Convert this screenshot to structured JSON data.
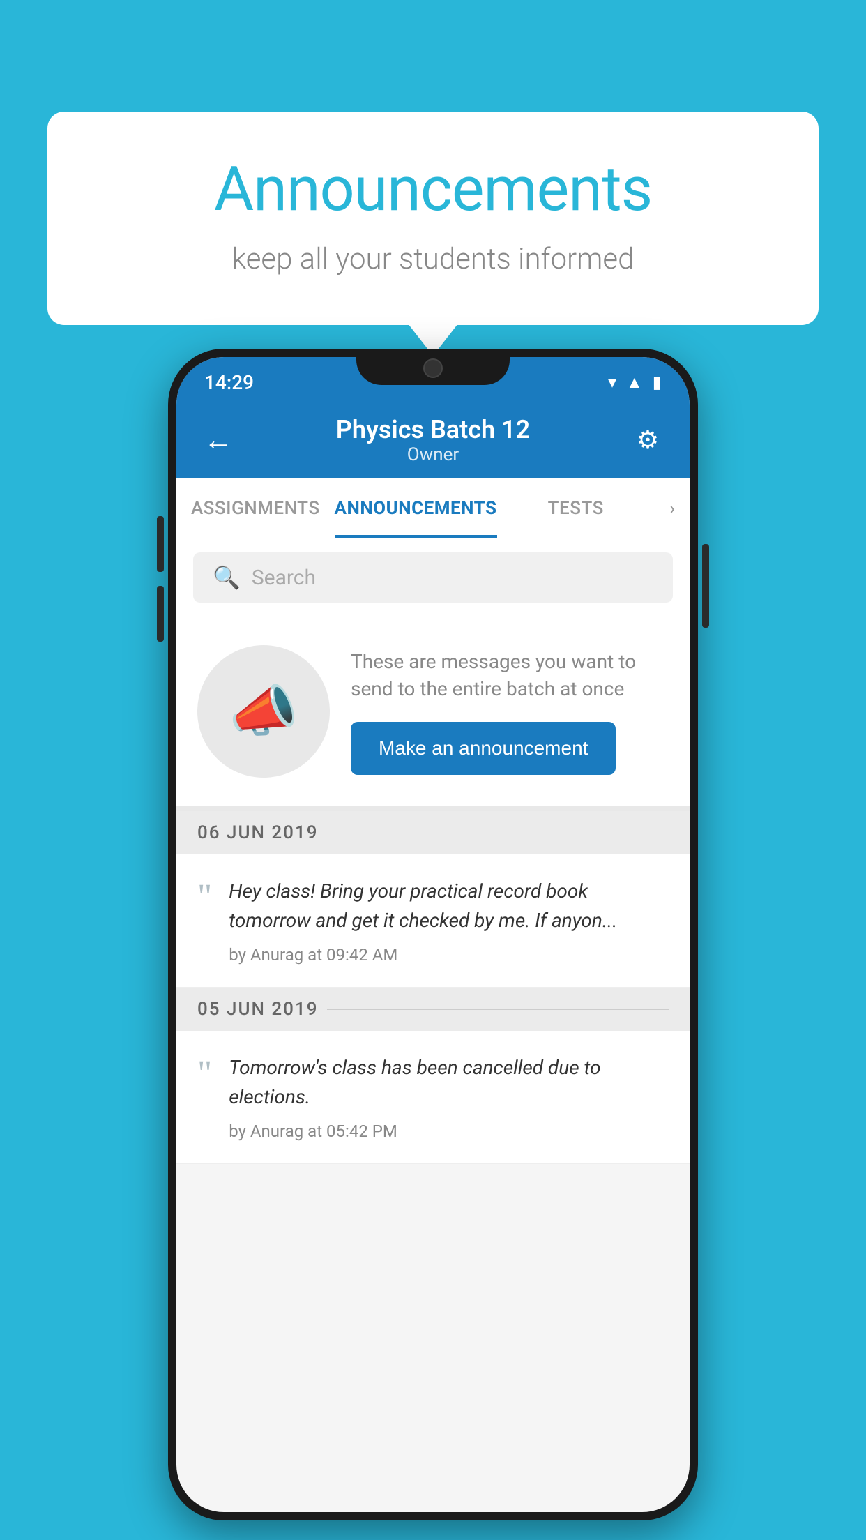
{
  "background_color": "#29b6d8",
  "speech_bubble": {
    "title": "Announcements",
    "subtitle": "keep all your students informed"
  },
  "phone": {
    "status_bar": {
      "time": "14:29",
      "icons": [
        "wifi",
        "signal",
        "battery"
      ]
    },
    "app_bar": {
      "title": "Physics Batch 12",
      "subtitle": "Owner",
      "back_label": "←",
      "settings_label": "⚙"
    },
    "tabs": [
      {
        "label": "ASSIGNMENTS",
        "active": false
      },
      {
        "label": "ANNOUNCEMENTS",
        "active": true
      },
      {
        "label": "TESTS",
        "active": false
      }
    ],
    "search": {
      "placeholder": "Search"
    },
    "promo": {
      "description": "These are messages you want to send to the entire batch at once",
      "button_label": "Make an announcement"
    },
    "announcements": [
      {
        "date": "06  JUN  2019",
        "text": "Hey class! Bring your practical record book tomorrow and get it checked by me. If anyon...",
        "meta": "by Anurag at 09:42 AM"
      },
      {
        "date": "05  JUN  2019",
        "text": "Tomorrow's class has been cancelled due to elections.",
        "meta": "by Anurag at 05:42 PM"
      }
    ]
  }
}
